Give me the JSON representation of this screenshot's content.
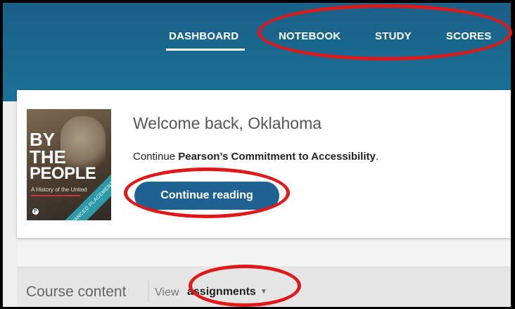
{
  "nav": {
    "items": [
      {
        "label": "DASHBOARD",
        "active": true
      },
      {
        "label": "NOTEBOOK",
        "active": false
      },
      {
        "label": "STUDY",
        "active": false
      },
      {
        "label": "SCORES",
        "active": false
      }
    ]
  },
  "book": {
    "title_lines": [
      "BY",
      "THE",
      "PEOPLE"
    ],
    "subtitle": "A History of the United",
    "band": "ADVANCED PLACEMENT",
    "logo": "P"
  },
  "welcome": {
    "greeting": "Welcome back, Oklahoma",
    "continue_prefix": "Continue ",
    "book_name": "Pearson’s Commitment to Accessibility",
    "continue_suffix": ".",
    "button_label": "Continue reading"
  },
  "course": {
    "title": "Course content",
    "view_label": "View",
    "view_value": "assignments",
    "caret": "▼"
  },
  "colors": {
    "header": "#1b6a92",
    "button": "#1f6292",
    "annotation": "#e01818"
  }
}
